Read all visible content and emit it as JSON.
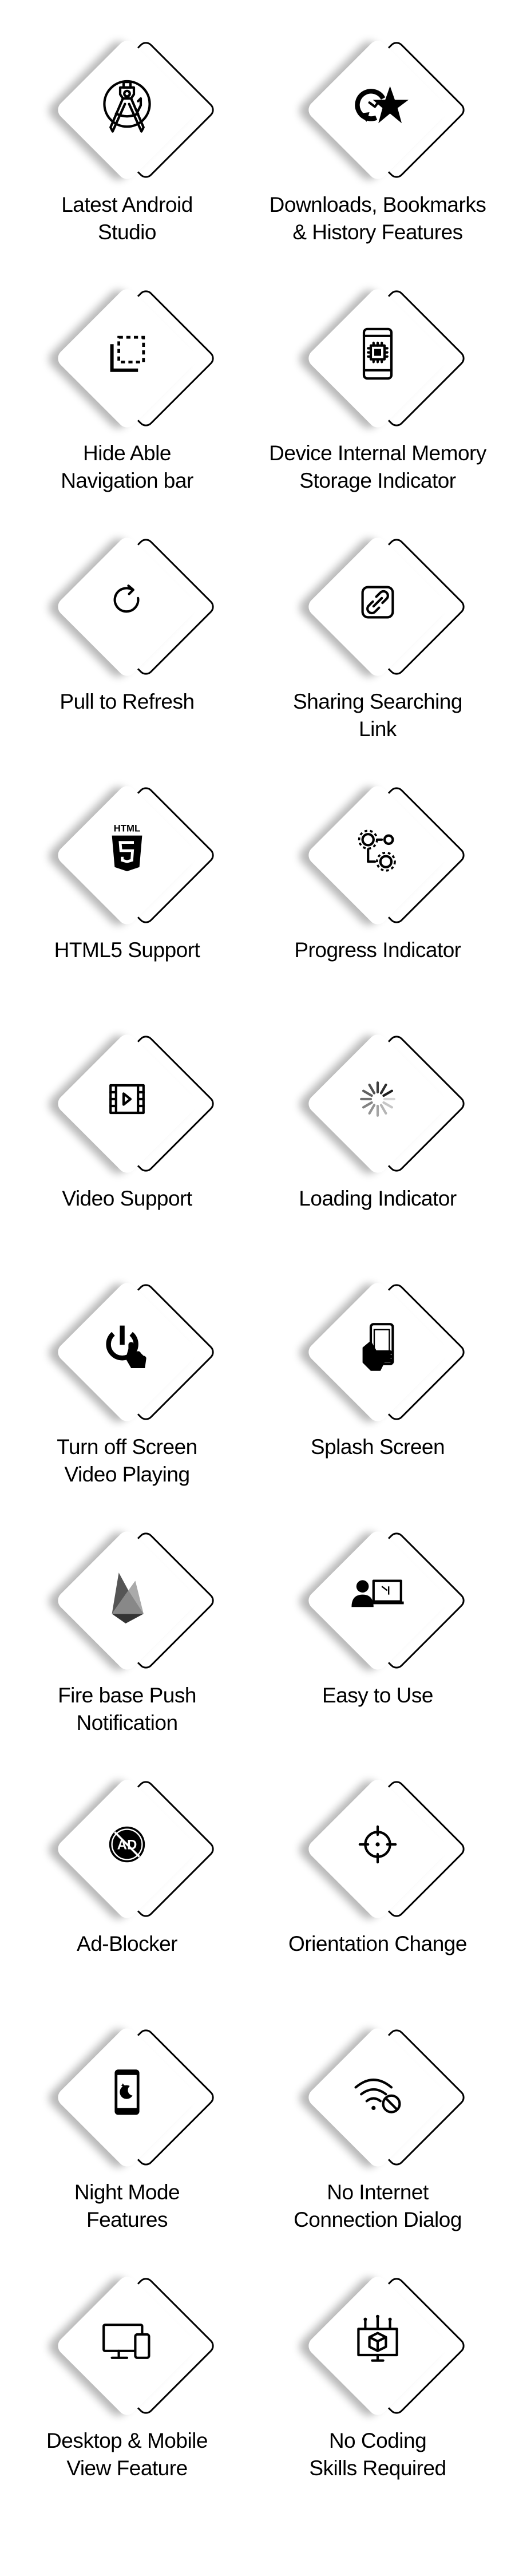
{
  "features": [
    {
      "lines": [
        "Latest Android",
        "Studio"
      ],
      "icon": "android-studio-compass-icon"
    },
    {
      "lines": [
        "Downloads, Bookmarks",
        "& History Features"
      ],
      "icon": "history-star-icon"
    },
    {
      "lines": [
        "Hide Able",
        "Navigation bar"
      ],
      "icon": "hide-navigation-icon"
    },
    {
      "lines": [
        "Device Internal Memory",
        "Storage Indicator"
      ],
      "icon": "phone-chip-icon"
    },
    {
      "lines": [
        "Pull to Refresh"
      ],
      "icon": "refresh-icon"
    },
    {
      "lines": [
        "Sharing Searching",
        "Link"
      ],
      "icon": "share-link-icon"
    },
    {
      "lines": [
        "HTML5 Support"
      ],
      "icon": "html5-icon",
      "logo_text": "HTML"
    },
    {
      "lines": [
        "Progress Indicator"
      ],
      "icon": "gears-progress-icon"
    },
    {
      "lines": [
        "Video Support"
      ],
      "icon": "video-film-icon"
    },
    {
      "lines": [
        "Loading Indicator"
      ],
      "icon": "loading-spinner-icon"
    },
    {
      "lines": [
        "Turn off Screen",
        "Video Playing"
      ],
      "icon": "power-touch-icon"
    },
    {
      "lines": [
        "Splash Screen"
      ],
      "icon": "hand-phone-icon"
    },
    {
      "lines": [
        "Fire base Push",
        "Notification"
      ],
      "icon": "firebase-icon"
    },
    {
      "lines": [
        "Easy to Use"
      ],
      "icon": "user-computer-icon"
    },
    {
      "lines": [
        "Ad-Blocker"
      ],
      "icon": "ad-block-icon",
      "logo_text": "AD"
    },
    {
      "lines": [
        "Orientation Change"
      ],
      "icon": "crosshair-icon"
    },
    {
      "lines": [
        "Night Mode",
        "Features"
      ],
      "icon": "phone-moon-icon"
    },
    {
      "lines": [
        "No Internet",
        "Connection Dialog"
      ],
      "icon": "wifi-blocked-icon"
    },
    {
      "lines": [
        "Desktop & Mobile",
        "View Feature"
      ],
      "icon": "desktop-mobile-icon"
    },
    {
      "lines": [
        "No Coding",
        "Skills Required"
      ],
      "icon": "monitor-cube-icon"
    }
  ],
  "colors": {
    "text": "#000000",
    "background": "#ffffff",
    "tile": "#ffffff",
    "outline": "#000000"
  }
}
